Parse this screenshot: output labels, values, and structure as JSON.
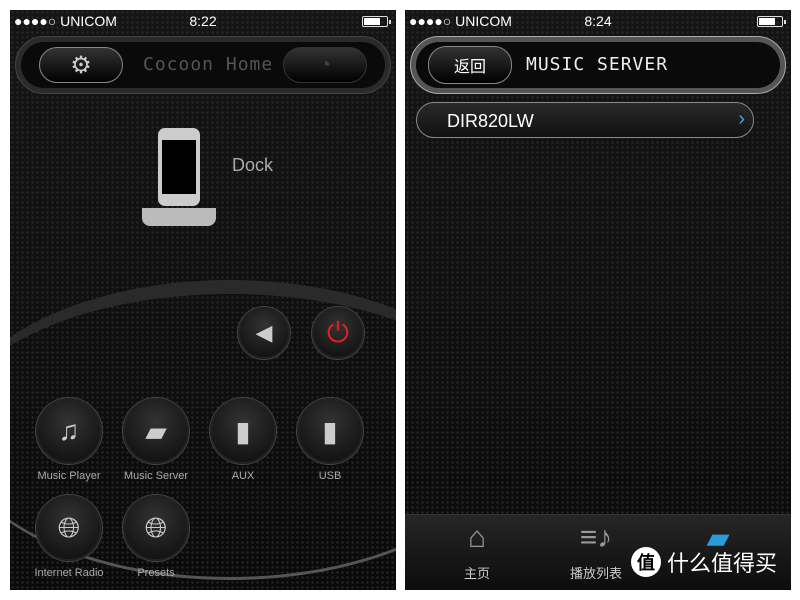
{
  "left": {
    "status": {
      "carrier": "●●●●○ UNICOM",
      "time": "8:22"
    },
    "header": {
      "title": "Cocoon Home",
      "settings_icon": "gear-icon",
      "right_icon": "gauge-icon"
    },
    "dock_label": "Dock",
    "sources": [
      {
        "label": "Music Player",
        "icon": "ipod-icon"
      },
      {
        "label": "Music Server",
        "icon": "folder-icon"
      },
      {
        "label": "AUX",
        "icon": "aux-plug-icon"
      },
      {
        "label": "USB",
        "icon": "usb-icon"
      },
      {
        "label": "Internet Radio",
        "icon": "globe-radio-icon"
      },
      {
        "label": "Presets",
        "icon": "globe-preset-icon"
      }
    ],
    "power_color": "#e02020"
  },
  "right": {
    "status": {
      "carrier": "●●●●○ UNICOM",
      "time": "8:24"
    },
    "header": {
      "back": "返回",
      "title": "MUSIC SERVER"
    },
    "servers": [
      {
        "name": "DIR820LW"
      }
    ],
    "tabs": [
      {
        "label": "主页",
        "icon": "home-icon"
      },
      {
        "label": "播放列表",
        "icon": "playlist-icon"
      },
      {
        "label": "",
        "icon": "folder-icon",
        "active": true
      }
    ],
    "accent": "#2a9ad8"
  },
  "watermark": {
    "badge": "值",
    "text": "什么值得买"
  }
}
